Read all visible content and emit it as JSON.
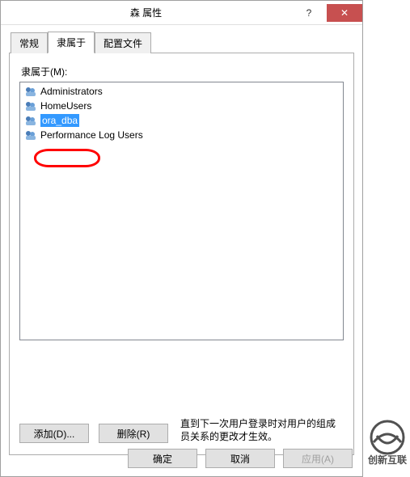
{
  "titlebar": {
    "title": "森 属性",
    "help_glyph": "?",
    "close_glyph": "✕"
  },
  "tabs": {
    "general": "常规",
    "memberof": "隶属于",
    "profile": "配置文件"
  },
  "section_label": "隶属于(M):",
  "groups": {
    "items": [
      {
        "label": "Administrators"
      },
      {
        "label": "HomeUsers"
      },
      {
        "label": "ora_dba"
      },
      {
        "label": "Performance Log Users"
      }
    ]
  },
  "buttons": {
    "add": "添加(D)...",
    "remove": "删除(R)",
    "ok": "确定",
    "cancel": "取消",
    "apply": "应用(A)"
  },
  "hint_text": "直到下一次用户登录时对用户的组成员关系的更改才生效。",
  "watermark": {
    "brand_top": "创新互联"
  }
}
